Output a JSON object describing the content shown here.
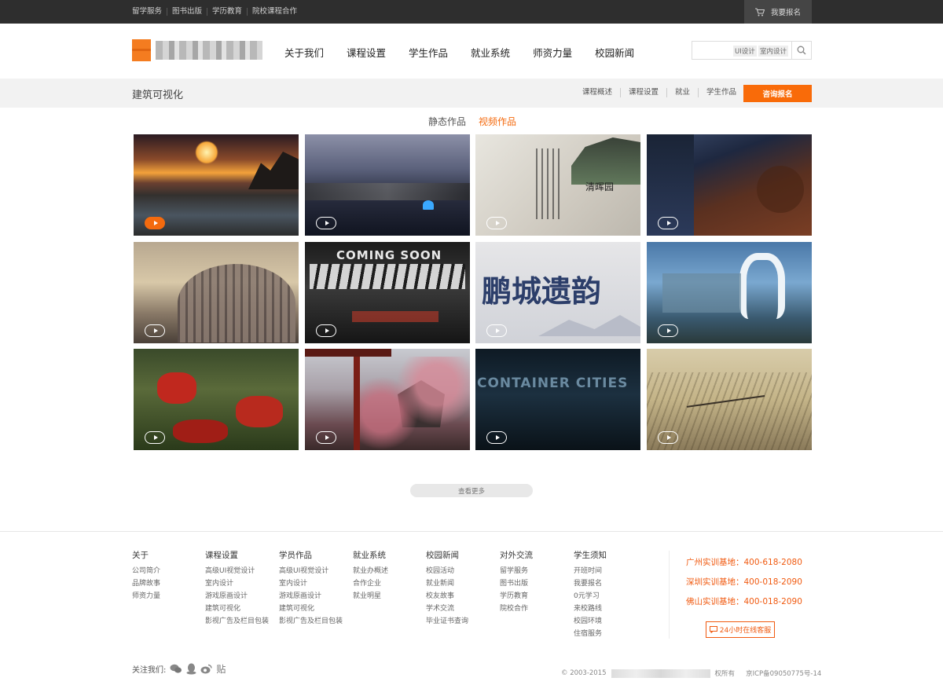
{
  "top_bar": {
    "links": [
      "留学服务",
      "图书出版",
      "学历教育",
      "院校课程合作"
    ],
    "signup": "我要报名"
  },
  "header": {
    "nav": [
      "关于我们",
      "课程设置",
      "学生作品",
      "就业系统",
      "师资力量",
      "校园新闻"
    ],
    "search_tags": [
      "UI设计",
      "室内设计"
    ]
  },
  "subbar": {
    "title": "建筑可视化",
    "links": [
      "课程概述",
      "课程设置",
      "就业",
      "学生作品"
    ],
    "consult": "咨询报名"
  },
  "tabs": {
    "static": "静态作品",
    "video": "视频作品"
  },
  "gallery": {
    "items": [
      {
        "name": "sunset-coast",
        "playing": true
      },
      {
        "name": "night-harbor",
        "playing": false
      },
      {
        "name": "ink-calligraphy",
        "playing": false
      },
      {
        "name": "rooftop-dusk",
        "playing": false
      },
      {
        "name": "dome-building",
        "playing": false
      },
      {
        "name": "coming-soon-graffiti",
        "playing": false
      },
      {
        "name": "ink-title",
        "playing": false
      },
      {
        "name": "futuristic-arch",
        "playing": false
      },
      {
        "name": "voxel-flowers",
        "playing": false
      },
      {
        "name": "pagoda-blossom",
        "playing": false
      },
      {
        "name": "container-cities",
        "playing": false
      },
      {
        "name": "sepia-city",
        "playing": false
      }
    ],
    "text_marks": {
      "coming_soon": "COMING SOON",
      "container": "CONTAINER CITIES",
      "ink_title": "鹏城遗韵",
      "calligraphy_title": "清晖园"
    }
  },
  "more_button": "查看更多",
  "footer": {
    "columns": [
      {
        "heading": "关于",
        "items": [
          "公司简介",
          "品牌故事",
          "师资力量"
        ]
      },
      {
        "heading": "课程设置",
        "items": [
          "高级UI视觉设计",
          "室内设计",
          "游戏原画设计",
          "建筑可视化",
          "影视广告及栏目包装"
        ]
      },
      {
        "heading": "学员作品",
        "items": [
          "高级UI视觉设计",
          "室内设计",
          "游戏原画设计",
          "建筑可视化",
          "影视广告及栏目包装"
        ]
      },
      {
        "heading": "就业系统",
        "items": [
          "就业办概述",
          "合作企业",
          "就业明星"
        ]
      },
      {
        "heading": "校园新闻",
        "items": [
          "校园活动",
          "就业新闻",
          "校友故事",
          "学术交流",
          "毕业证书查询"
        ]
      },
      {
        "heading": "对外交流",
        "items": [
          "留学服务",
          "图书出版",
          "学历教育",
          "院校合作"
        ]
      },
      {
        "heading": "学生须知",
        "items": [
          "开班时间",
          "我要报名",
          "0元学习",
          "来校路线",
          "校园环境",
          "住宿服务"
        ]
      }
    ],
    "phones": [
      "广州实训基地：400-618-2080",
      "深圳实训基地：400-018-2090",
      "佛山实训基地：400-018-2090"
    ],
    "online": "24小时在线客服",
    "follow": "关注我们:",
    "tieba": "贴",
    "copyright": "© 2003-2015",
    "rights": "权所有",
    "icp": "京ICP备09050775号-14"
  }
}
